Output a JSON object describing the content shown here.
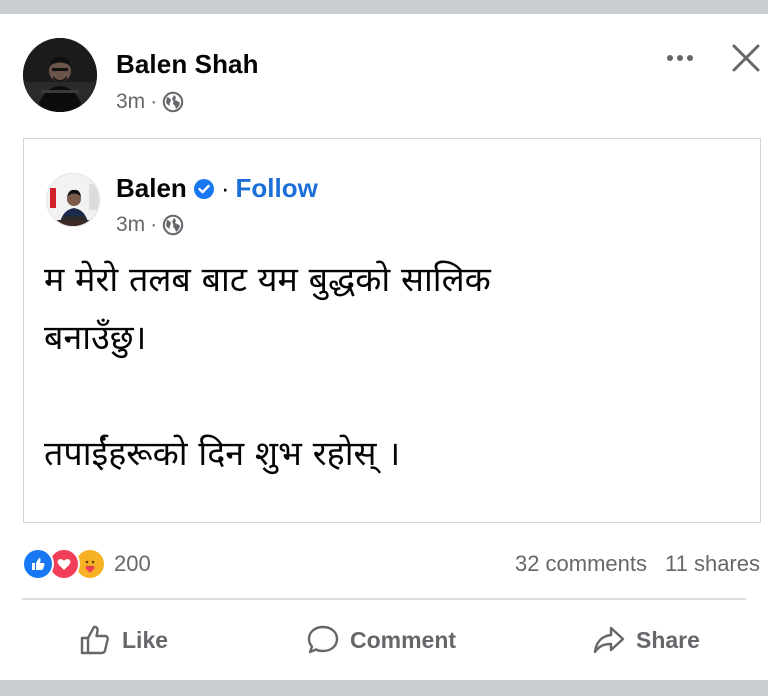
{
  "post": {
    "author": "Balen Shah",
    "time": "3m",
    "separator": "·",
    "icons": {
      "more": "more-options-icon",
      "close": "close-icon",
      "audience": "globe-icon"
    }
  },
  "shared": {
    "author": "Balen",
    "verified": true,
    "follow_label": "Follow",
    "separator": "·",
    "time": "3m",
    "text_lines": [
      "म मेरो तलब बाट यम बुद्धको सालिक",
      "बनाउँछु।",
      "",
      "तपाईंहरूको दिन शुभ रहोस् ।"
    ]
  },
  "stats": {
    "reaction_count": "200",
    "reactions": [
      "like",
      "love",
      "care"
    ],
    "comments": "32 comments",
    "shares": "11 shares"
  },
  "actions": {
    "like": "Like",
    "comment": "Comment",
    "share": "Share"
  },
  "colors": {
    "accent": "#1b6fd6",
    "like": "#1877f2",
    "love": "#f33e58",
    "care": "#f7b125",
    "muted": "#65676b",
    "band": "#c9ccd1"
  }
}
